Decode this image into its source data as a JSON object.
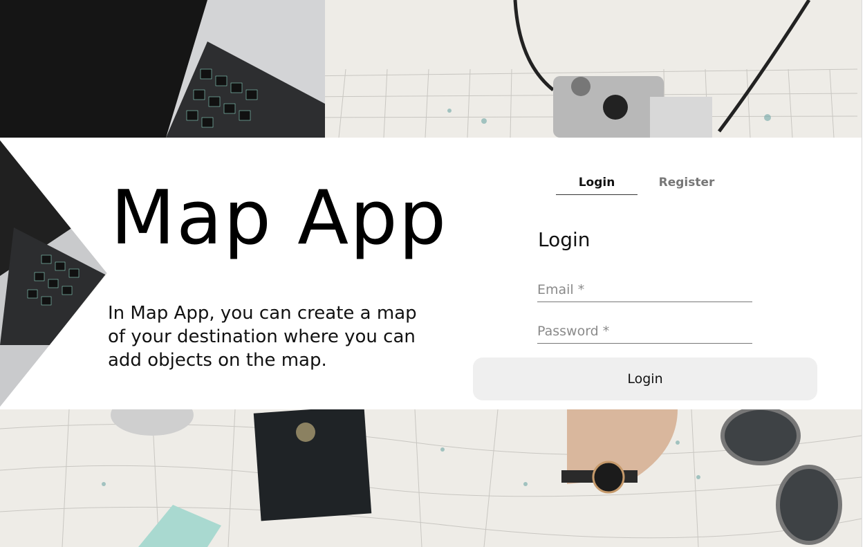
{
  "hero": {
    "title": "Map App",
    "description": "In Map App, you can create a map of your destination where you can add objects on the map."
  },
  "tabs": [
    {
      "label": "Login",
      "active": true
    },
    {
      "label": "Register",
      "active": false
    }
  ],
  "form": {
    "title": "Login",
    "email_placeholder": "Email *",
    "password_placeholder": "Password *",
    "submit_label": "Login"
  },
  "colors": {
    "band": "#ffffff",
    "button_bg": "#efefef",
    "tab_inactive": "#777777",
    "map_paper": "#eeece7"
  },
  "background_icons": [
    "laptop-icon",
    "camera-icon",
    "passport-icon",
    "watch-icon",
    "sunglasses-icon"
  ]
}
